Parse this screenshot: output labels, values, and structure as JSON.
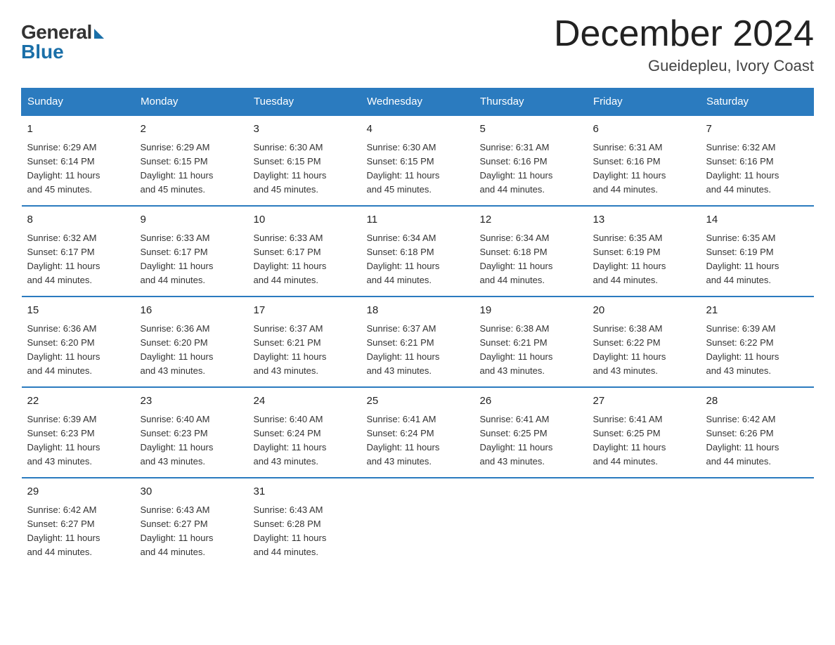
{
  "header": {
    "logo_general": "General",
    "logo_blue": "Blue",
    "month_title": "December 2024",
    "location": "Gueidepleu, Ivory Coast"
  },
  "days_of_week": [
    "Sunday",
    "Monday",
    "Tuesday",
    "Wednesday",
    "Thursday",
    "Friday",
    "Saturday"
  ],
  "weeks": [
    [
      {
        "num": "1",
        "info": "Sunrise: 6:29 AM\nSunset: 6:14 PM\nDaylight: 11 hours\nand 45 minutes."
      },
      {
        "num": "2",
        "info": "Sunrise: 6:29 AM\nSunset: 6:15 PM\nDaylight: 11 hours\nand 45 minutes."
      },
      {
        "num": "3",
        "info": "Sunrise: 6:30 AM\nSunset: 6:15 PM\nDaylight: 11 hours\nand 45 minutes."
      },
      {
        "num": "4",
        "info": "Sunrise: 6:30 AM\nSunset: 6:15 PM\nDaylight: 11 hours\nand 45 minutes."
      },
      {
        "num": "5",
        "info": "Sunrise: 6:31 AM\nSunset: 6:16 PM\nDaylight: 11 hours\nand 44 minutes."
      },
      {
        "num": "6",
        "info": "Sunrise: 6:31 AM\nSunset: 6:16 PM\nDaylight: 11 hours\nand 44 minutes."
      },
      {
        "num": "7",
        "info": "Sunrise: 6:32 AM\nSunset: 6:16 PM\nDaylight: 11 hours\nand 44 minutes."
      }
    ],
    [
      {
        "num": "8",
        "info": "Sunrise: 6:32 AM\nSunset: 6:17 PM\nDaylight: 11 hours\nand 44 minutes."
      },
      {
        "num": "9",
        "info": "Sunrise: 6:33 AM\nSunset: 6:17 PM\nDaylight: 11 hours\nand 44 minutes."
      },
      {
        "num": "10",
        "info": "Sunrise: 6:33 AM\nSunset: 6:17 PM\nDaylight: 11 hours\nand 44 minutes."
      },
      {
        "num": "11",
        "info": "Sunrise: 6:34 AM\nSunset: 6:18 PM\nDaylight: 11 hours\nand 44 minutes."
      },
      {
        "num": "12",
        "info": "Sunrise: 6:34 AM\nSunset: 6:18 PM\nDaylight: 11 hours\nand 44 minutes."
      },
      {
        "num": "13",
        "info": "Sunrise: 6:35 AM\nSunset: 6:19 PM\nDaylight: 11 hours\nand 44 minutes."
      },
      {
        "num": "14",
        "info": "Sunrise: 6:35 AM\nSunset: 6:19 PM\nDaylight: 11 hours\nand 44 minutes."
      }
    ],
    [
      {
        "num": "15",
        "info": "Sunrise: 6:36 AM\nSunset: 6:20 PM\nDaylight: 11 hours\nand 44 minutes."
      },
      {
        "num": "16",
        "info": "Sunrise: 6:36 AM\nSunset: 6:20 PM\nDaylight: 11 hours\nand 43 minutes."
      },
      {
        "num": "17",
        "info": "Sunrise: 6:37 AM\nSunset: 6:21 PM\nDaylight: 11 hours\nand 43 minutes."
      },
      {
        "num": "18",
        "info": "Sunrise: 6:37 AM\nSunset: 6:21 PM\nDaylight: 11 hours\nand 43 minutes."
      },
      {
        "num": "19",
        "info": "Sunrise: 6:38 AM\nSunset: 6:21 PM\nDaylight: 11 hours\nand 43 minutes."
      },
      {
        "num": "20",
        "info": "Sunrise: 6:38 AM\nSunset: 6:22 PM\nDaylight: 11 hours\nand 43 minutes."
      },
      {
        "num": "21",
        "info": "Sunrise: 6:39 AM\nSunset: 6:22 PM\nDaylight: 11 hours\nand 43 minutes."
      }
    ],
    [
      {
        "num": "22",
        "info": "Sunrise: 6:39 AM\nSunset: 6:23 PM\nDaylight: 11 hours\nand 43 minutes."
      },
      {
        "num": "23",
        "info": "Sunrise: 6:40 AM\nSunset: 6:23 PM\nDaylight: 11 hours\nand 43 minutes."
      },
      {
        "num": "24",
        "info": "Sunrise: 6:40 AM\nSunset: 6:24 PM\nDaylight: 11 hours\nand 43 minutes."
      },
      {
        "num": "25",
        "info": "Sunrise: 6:41 AM\nSunset: 6:24 PM\nDaylight: 11 hours\nand 43 minutes."
      },
      {
        "num": "26",
        "info": "Sunrise: 6:41 AM\nSunset: 6:25 PM\nDaylight: 11 hours\nand 43 minutes."
      },
      {
        "num": "27",
        "info": "Sunrise: 6:41 AM\nSunset: 6:25 PM\nDaylight: 11 hours\nand 44 minutes."
      },
      {
        "num": "28",
        "info": "Sunrise: 6:42 AM\nSunset: 6:26 PM\nDaylight: 11 hours\nand 44 minutes."
      }
    ],
    [
      {
        "num": "29",
        "info": "Sunrise: 6:42 AM\nSunset: 6:27 PM\nDaylight: 11 hours\nand 44 minutes."
      },
      {
        "num": "30",
        "info": "Sunrise: 6:43 AM\nSunset: 6:27 PM\nDaylight: 11 hours\nand 44 minutes."
      },
      {
        "num": "31",
        "info": "Sunrise: 6:43 AM\nSunset: 6:28 PM\nDaylight: 11 hours\nand 44 minutes."
      },
      {
        "num": "",
        "info": ""
      },
      {
        "num": "",
        "info": ""
      },
      {
        "num": "",
        "info": ""
      },
      {
        "num": "",
        "info": ""
      }
    ]
  ]
}
